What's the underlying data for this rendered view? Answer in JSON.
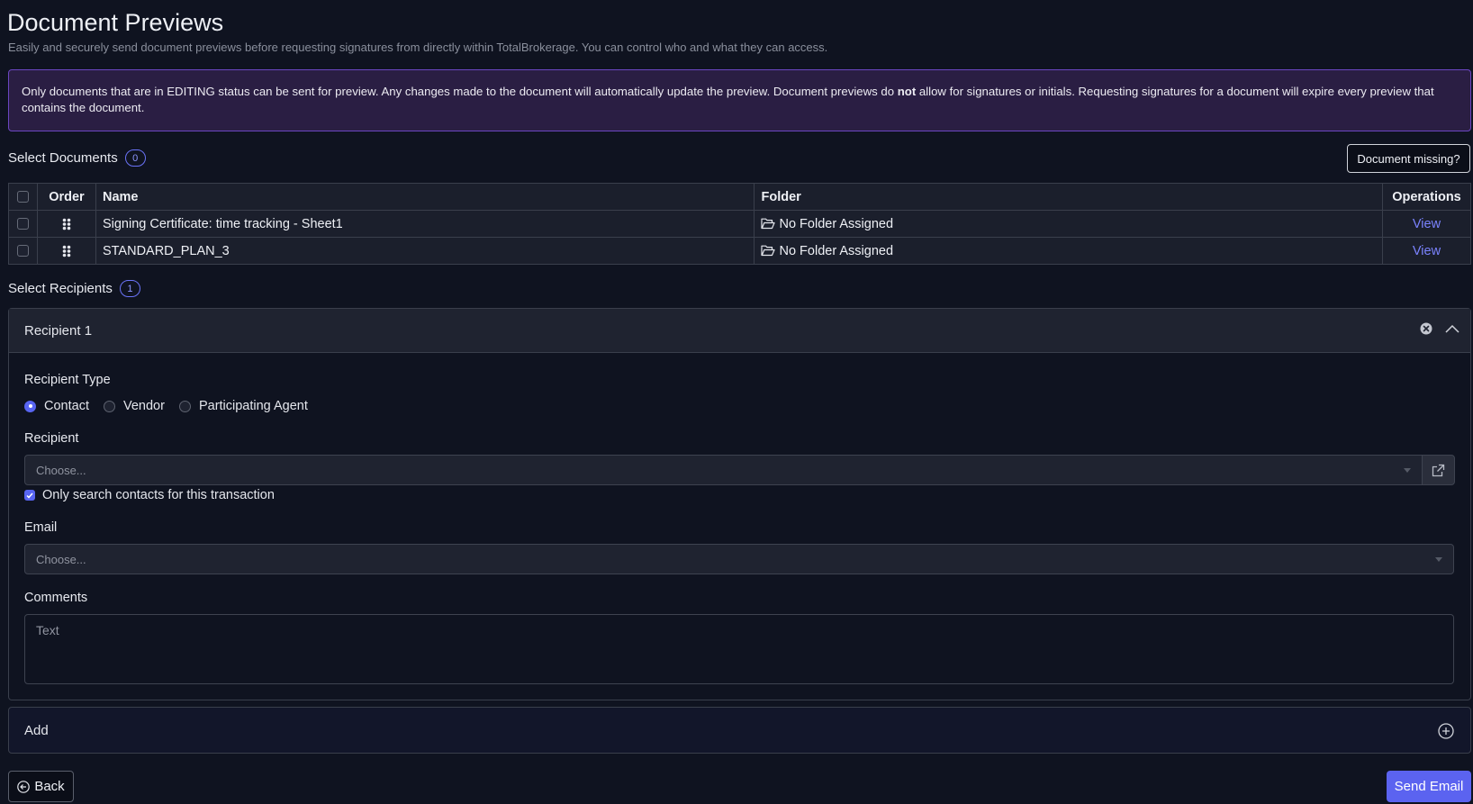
{
  "header": {
    "title": "Document Previews",
    "subtitle": "Easily and securely send document previews before requesting signatures from directly within TotalBrokerage. You can control who and what they can access."
  },
  "notice": {
    "text_before": "Only documents that are in EDITING status can be sent for preview. Any changes made to the document will automatically update the preview. Document previews do ",
    "bold": "not",
    "text_after": " allow for signatures or initials. Requesting signatures for a document will expire every preview that contains the document."
  },
  "documents": {
    "heading": "Select Documents",
    "count": "0",
    "missing_button": "Document missing?",
    "columns": {
      "order": "Order",
      "name": "Name",
      "folder": "Folder",
      "operations": "Operations"
    },
    "rows": [
      {
        "name": "Signing Certificate: time tracking - Sheet1",
        "folder": "No Folder Assigned",
        "action": "View"
      },
      {
        "name": "STANDARD_PLAN_3",
        "folder": "No Folder Assigned",
        "action": "View"
      }
    ]
  },
  "recipients": {
    "heading": "Select Recipients",
    "count": "1",
    "card": {
      "title": "Recipient 1",
      "type_label": "Recipient Type",
      "types": [
        "Contact",
        "Vendor",
        "Participating Agent"
      ],
      "selected_type": "Contact",
      "recipient_label": "Recipient",
      "recipient_placeholder": "Choose...",
      "only_contacts_label": "Only search contacts for this transaction",
      "only_contacts_checked": true,
      "email_label": "Email",
      "email_placeholder": "Choose...",
      "comments_label": "Comments",
      "comments_placeholder": "Text"
    },
    "add_label": "Add"
  },
  "footer": {
    "back_label": "Back",
    "send_label": "Send Email"
  },
  "colors": {
    "background": "#0f1320",
    "accent": "#5b63f0",
    "notice_bg": "#2a1e43",
    "notice_border": "#6b46c1"
  }
}
